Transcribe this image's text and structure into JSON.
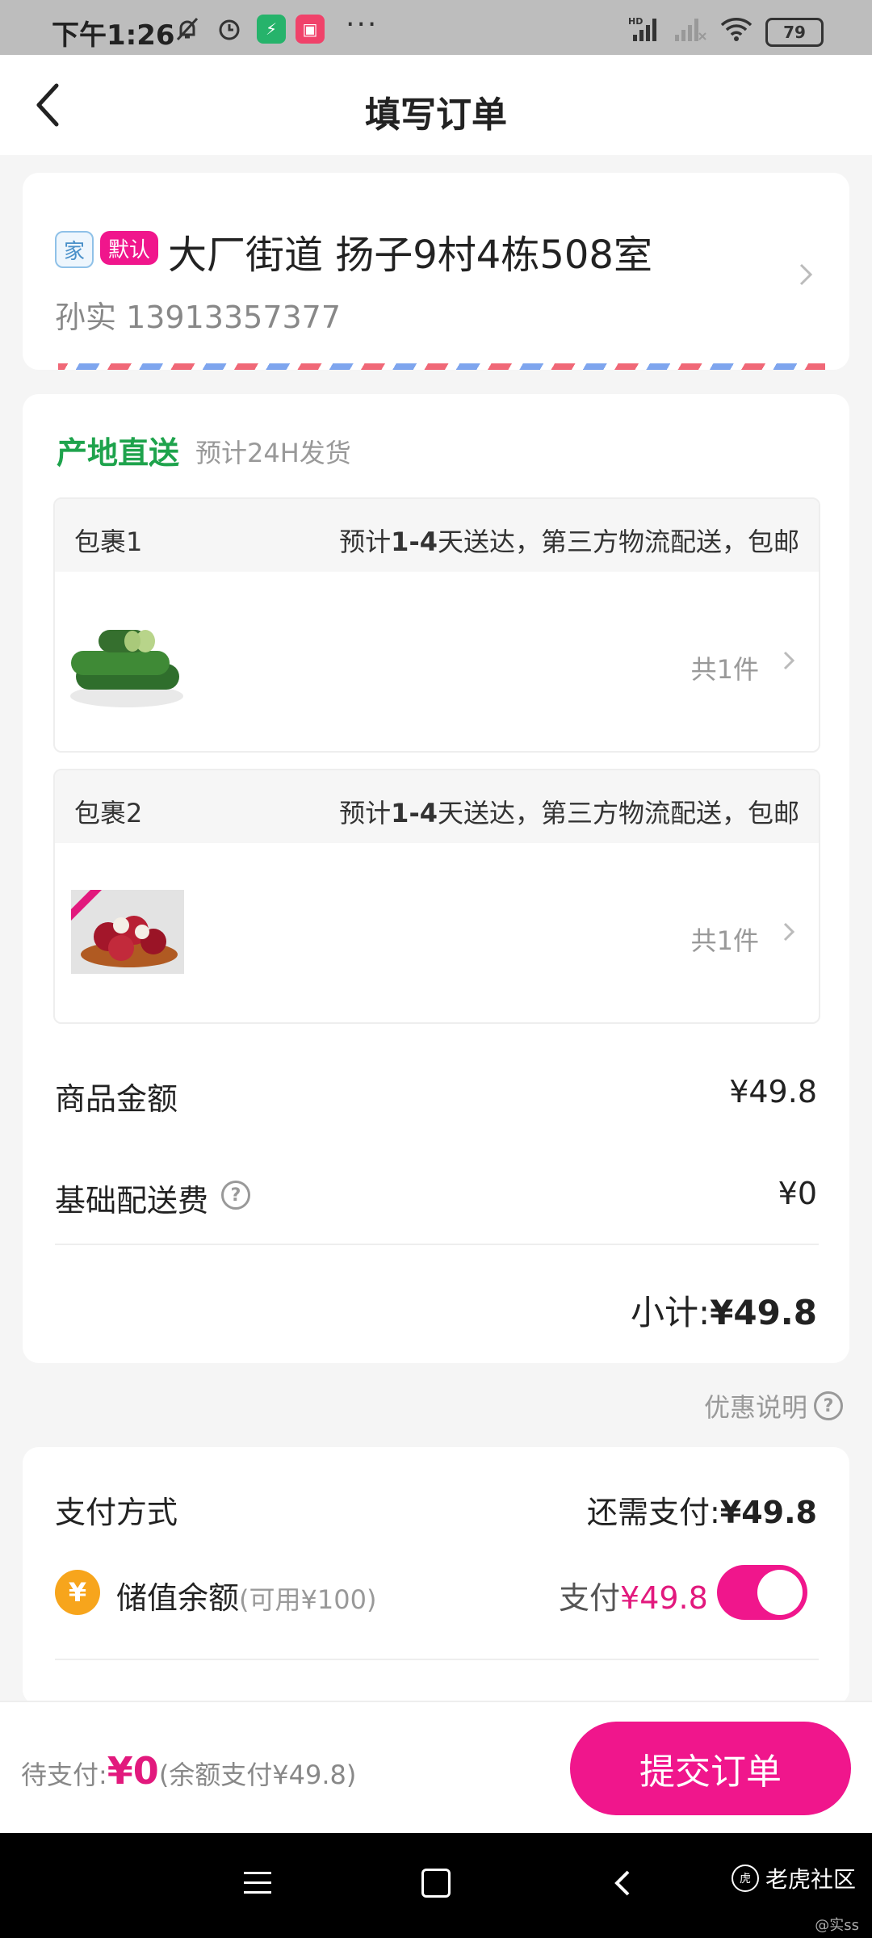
{
  "status_bar": {
    "time": "下午1:26",
    "icons": [
      "mute-icon",
      "alarm-icon",
      "app-shield-icon",
      "app-video-icon",
      "more-dots-icon",
      "hd-signal-icon",
      "no-signal-icon",
      "wifi-icon"
    ],
    "battery": "79"
  },
  "header": {
    "title": "填写订单"
  },
  "address": {
    "tag_home": "家",
    "tag_default": "默认",
    "text": "大厂街道 扬子9村4栋508室",
    "contact": "孙实 13913357377"
  },
  "goods": {
    "origin_label": "产地直送",
    "origin_note": "预计24H发货",
    "packages": [
      {
        "name": "包裹1",
        "ship_prefix": "预计",
        "ship_days": "1-4",
        "ship_suffix": "天送达，第三方物流配送，包邮",
        "count": "共1件",
        "image": "cucumber"
      },
      {
        "name": "包裹2",
        "ship_prefix": "预计",
        "ship_days": "1-4",
        "ship_suffix": "天送达，第三方物流配送，包邮",
        "count": "共1件",
        "image": "lychee"
      }
    ],
    "goods_amount_label": "商品金额",
    "goods_amount": "¥49.8",
    "shipping_label": "基础配送费",
    "shipping_fee": "¥0",
    "subtotal_label": "小计:",
    "subtotal": "¥49.8"
  },
  "promo_note": "优惠说明",
  "payment": {
    "title": "支付方式",
    "need_label": "还需支付:",
    "need_amount": "¥49.8",
    "balance_label": "储值余额",
    "balance_available": "(可用¥100)",
    "pay_label": "支付",
    "pay_amount": "¥49.8",
    "toggle_on": true
  },
  "footer": {
    "to_pay_label": "待支付:",
    "to_pay_amount": "¥0",
    "to_pay_note": "(余额支付¥49.8)",
    "submit_label": "提交订单"
  },
  "watermark": {
    "brand": "老虎社区",
    "user": "@实ss"
  },
  "colors": {
    "accent": "#f0168c",
    "origin_green": "#1ea34c",
    "coin": "#f7a51c"
  }
}
